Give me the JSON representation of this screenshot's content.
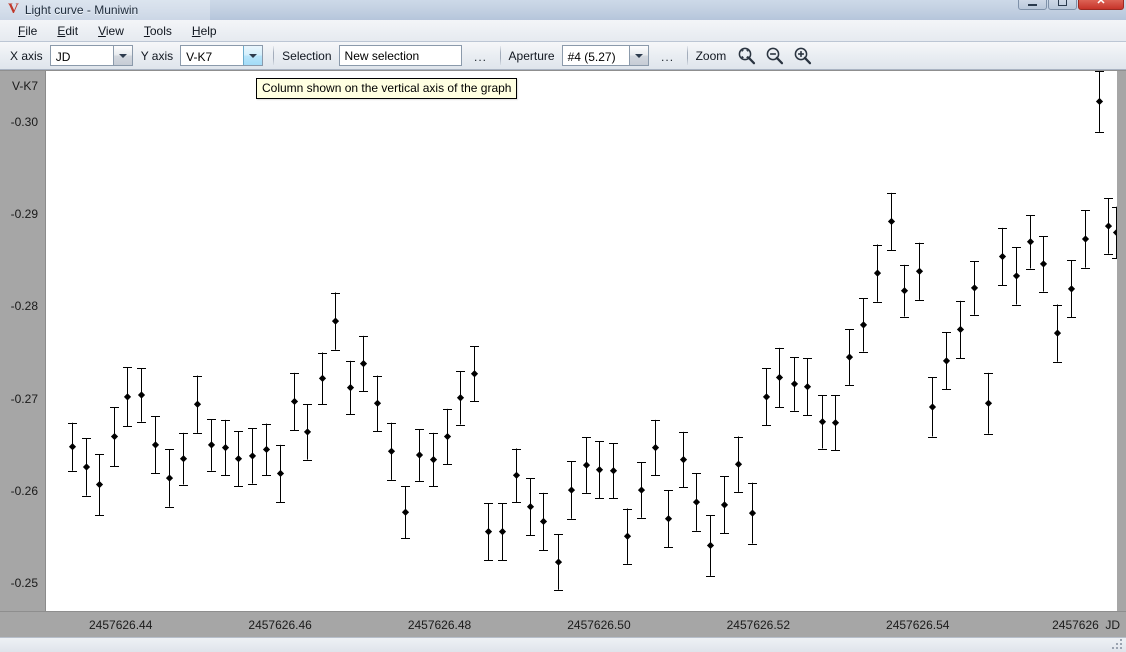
{
  "window": {
    "title": "Light curve - Muniwin",
    "logo": "V",
    "controls": [
      {
        "name": "minimize",
        "glyph": "minimize-icon"
      },
      {
        "name": "maximize",
        "glyph": "maximize-icon"
      },
      {
        "name": "close",
        "glyph": "close-icon",
        "label": "✕"
      }
    ]
  },
  "menubar": {
    "items": [
      {
        "accel": "F",
        "rest": "ile"
      },
      {
        "accel": "E",
        "rest": "dit"
      },
      {
        "accel": "V",
        "rest": "iew"
      },
      {
        "accel": "T",
        "rest": "ools"
      },
      {
        "accel": "H",
        "rest": "elp"
      }
    ]
  },
  "toolbar": {
    "x_axis_label": "X axis",
    "x_axis_value": "JD",
    "y_axis_label": "Y axis",
    "y_axis_value": "V-K7",
    "selection_label": "Selection",
    "selection_value": "New selection",
    "selection_placeholder": "New selection",
    "selection_dots": "...",
    "aperture_label": "Aperture",
    "aperture_value": "#4 (5.27)",
    "aperture_dots": "...",
    "zoom_label": "Zoom",
    "zoom_fit_icon": "zoom-fit-icon",
    "zoom_out_icon": "zoom-out-icon",
    "zoom_in_icon": "zoom-in-icon"
  },
  "tooltip": {
    "text": "Column shown on the vertical axis of the graph"
  },
  "chart_data": {
    "type": "scatter",
    "title": "",
    "xlabel": "JD",
    "ylabel": "V-K7",
    "grid": false,
    "legend": null,
    "y_inverted": true,
    "xlim": [
      2457626.4305,
      2457626.565
    ],
    "ylim": [
      -0.3055,
      -0.247
    ],
    "yticks": [
      -0.3,
      -0.29,
      -0.28,
      -0.27,
      -0.26,
      -0.25
    ],
    "ytick_labels": [
      "-0.30",
      "-0.29",
      "-0.28",
      "-0.27",
      "-0.26",
      "-0.25"
    ],
    "xticks": [
      2457626.44,
      2457626.46,
      2457626.48,
      2457626.5,
      2457626.52,
      2457626.54,
      2457626.56
    ],
    "xtick_labels": [
      "2457626.44",
      "2457626.46",
      "2457626.48",
      "2457626.50",
      "2457626.52",
      "2457626.54",
      "2457626 "
    ],
    "marker": "diamond",
    "marker_color": "#000000",
    "errorbars": "vertical",
    "points": [
      {
        "x": 2457626.4337,
        "y": -0.2648,
        "e": 0.0026
      },
      {
        "x": 2457626.4355,
        "y": -0.2626,
        "e": 0.0031
      },
      {
        "x": 2457626.4372,
        "y": -0.2607,
        "e": 0.0033
      },
      {
        "x": 2457626.439,
        "y": -0.2659,
        "e": 0.0032
      },
      {
        "x": 2457626.4407,
        "y": -0.2702,
        "e": 0.0032
      },
      {
        "x": 2457626.4424,
        "y": -0.2704,
        "e": 0.0029
      },
      {
        "x": 2457626.4442,
        "y": -0.265,
        "e": 0.0031
      },
      {
        "x": 2457626.4459,
        "y": -0.2614,
        "e": 0.0031
      },
      {
        "x": 2457626.4477,
        "y": -0.2635,
        "e": 0.0028
      },
      {
        "x": 2457626.4494,
        "y": -0.2694,
        "e": 0.0031
      },
      {
        "x": 2457626.4512,
        "y": -0.265,
        "e": 0.0028
      },
      {
        "x": 2457626.4529,
        "y": -0.2647,
        "e": 0.003
      },
      {
        "x": 2457626.4546,
        "y": -0.2635,
        "e": 0.003
      },
      {
        "x": 2457626.4564,
        "y": -0.2638,
        "e": 0.003
      },
      {
        "x": 2457626.4581,
        "y": -0.2645,
        "e": 0.0028
      },
      {
        "x": 2457626.4599,
        "y": -0.2619,
        "e": 0.0031
      },
      {
        "x": 2457626.4616,
        "y": -0.2697,
        "e": 0.0031
      },
      {
        "x": 2457626.4633,
        "y": -0.2664,
        "e": 0.003
      },
      {
        "x": 2457626.4651,
        "y": -0.2722,
        "e": 0.0028
      },
      {
        "x": 2457626.4668,
        "y": -0.2784,
        "e": 0.0031
      },
      {
        "x": 2457626.4686,
        "y": -0.2712,
        "e": 0.0029
      },
      {
        "x": 2457626.4703,
        "y": -0.2738,
        "e": 0.003
      },
      {
        "x": 2457626.472,
        "y": -0.2695,
        "e": 0.003
      },
      {
        "x": 2457626.4738,
        "y": -0.2643,
        "e": 0.0031
      },
      {
        "x": 2457626.4755,
        "y": -0.2577,
        "e": 0.0028
      },
      {
        "x": 2457626.4773,
        "y": -0.2639,
        "e": 0.0028
      },
      {
        "x": 2457626.479,
        "y": -0.2634,
        "e": 0.0029
      },
      {
        "x": 2457626.4808,
        "y": -0.2659,
        "e": 0.003
      },
      {
        "x": 2457626.4825,
        "y": -0.2701,
        "e": 0.0029
      },
      {
        "x": 2457626.4842,
        "y": -0.2727,
        "e": 0.003
      },
      {
        "x": 2457626.486,
        "y": -0.2556,
        "e": 0.0031
      },
      {
        "x": 2457626.4877,
        "y": -0.2556,
        "e": 0.0031
      },
      {
        "x": 2457626.4895,
        "y": -0.2617,
        "e": 0.0029
      },
      {
        "x": 2457626.4912,
        "y": -0.2583,
        "e": 0.0031
      },
      {
        "x": 2457626.4929,
        "y": -0.2567,
        "e": 0.0031
      },
      {
        "x": 2457626.4947,
        "y": -0.2523,
        "e": 0.003
      },
      {
        "x": 2457626.4964,
        "y": -0.2601,
        "e": 0.0031
      },
      {
        "x": 2457626.4982,
        "y": -0.2628,
        "e": 0.003
      },
      {
        "x": 2457626.4999,
        "y": -0.2623,
        "e": 0.0031
      },
      {
        "x": 2457626.5016,
        "y": -0.2622,
        "e": 0.003
      },
      {
        "x": 2457626.5034,
        "y": -0.2551,
        "e": 0.003
      },
      {
        "x": 2457626.5051,
        "y": -0.2601,
        "e": 0.003
      },
      {
        "x": 2457626.5069,
        "y": -0.2647,
        "e": 0.003
      },
      {
        "x": 2457626.5086,
        "y": -0.257,
        "e": 0.0031
      },
      {
        "x": 2457626.5104,
        "y": -0.2634,
        "e": 0.003
      },
      {
        "x": 2457626.5121,
        "y": -0.2588,
        "e": 0.0031
      },
      {
        "x": 2457626.5138,
        "y": -0.2541,
        "e": 0.0033
      },
      {
        "x": 2457626.5156,
        "y": -0.2585,
        "e": 0.0031
      },
      {
        "x": 2457626.5173,
        "y": -0.2629,
        "e": 0.003
      },
      {
        "x": 2457626.5191,
        "y": -0.2576,
        "e": 0.0033
      },
      {
        "x": 2457626.5208,
        "y": -0.2702,
        "e": 0.0031
      },
      {
        "x": 2457626.5225,
        "y": -0.2723,
        "e": 0.0032
      },
      {
        "x": 2457626.5243,
        "y": -0.2716,
        "e": 0.0029
      },
      {
        "x": 2457626.526,
        "y": -0.2713,
        "e": 0.0031
      },
      {
        "x": 2457626.5278,
        "y": -0.2675,
        "e": 0.0029
      },
      {
        "x": 2457626.5295,
        "y": -0.2674,
        "e": 0.003
      },
      {
        "x": 2457626.5313,
        "y": -0.2745,
        "e": 0.003
      },
      {
        "x": 2457626.533,
        "y": -0.278,
        "e": 0.0029
      },
      {
        "x": 2457626.5347,
        "y": -0.2836,
        "e": 0.0031
      },
      {
        "x": 2457626.5365,
        "y": -0.2892,
        "e": 0.0031
      },
      {
        "x": 2457626.5382,
        "y": -0.2817,
        "e": 0.0028
      },
      {
        "x": 2457626.54,
        "y": -0.2838,
        "e": 0.0031
      },
      {
        "x": 2457626.5417,
        "y": -0.2691,
        "e": 0.0032
      },
      {
        "x": 2457626.5434,
        "y": -0.2741,
        "e": 0.0031
      },
      {
        "x": 2457626.5452,
        "y": -0.2775,
        "e": 0.0031
      },
      {
        "x": 2457626.5469,
        "y": -0.282,
        "e": 0.0029
      },
      {
        "x": 2457626.5487,
        "y": -0.2695,
        "e": 0.0033
      },
      {
        "x": 2457626.5504,
        "y": -0.2854,
        "e": 0.0031
      },
      {
        "x": 2457626.5522,
        "y": -0.2833,
        "e": 0.0031
      },
      {
        "x": 2457626.5539,
        "y": -0.287,
        "e": 0.0029
      },
      {
        "x": 2457626.5556,
        "y": -0.2846,
        "e": 0.003
      },
      {
        "x": 2457626.5574,
        "y": -0.2771,
        "e": 0.0031
      },
      {
        "x": 2457626.5591,
        "y": -0.2819,
        "e": 0.0031
      },
      {
        "x": 2457626.5609,
        "y": -0.2873,
        "e": 0.0031
      },
      {
        "x": 2457626.5626,
        "y": -0.3022,
        "e": 0.0033
      },
      {
        "x": 2457626.5638,
        "y": -0.2887,
        "e": 0.003
      },
      {
        "x": 2457626.5648,
        "y": -0.288,
        "e": 0.0028
      }
    ]
  }
}
